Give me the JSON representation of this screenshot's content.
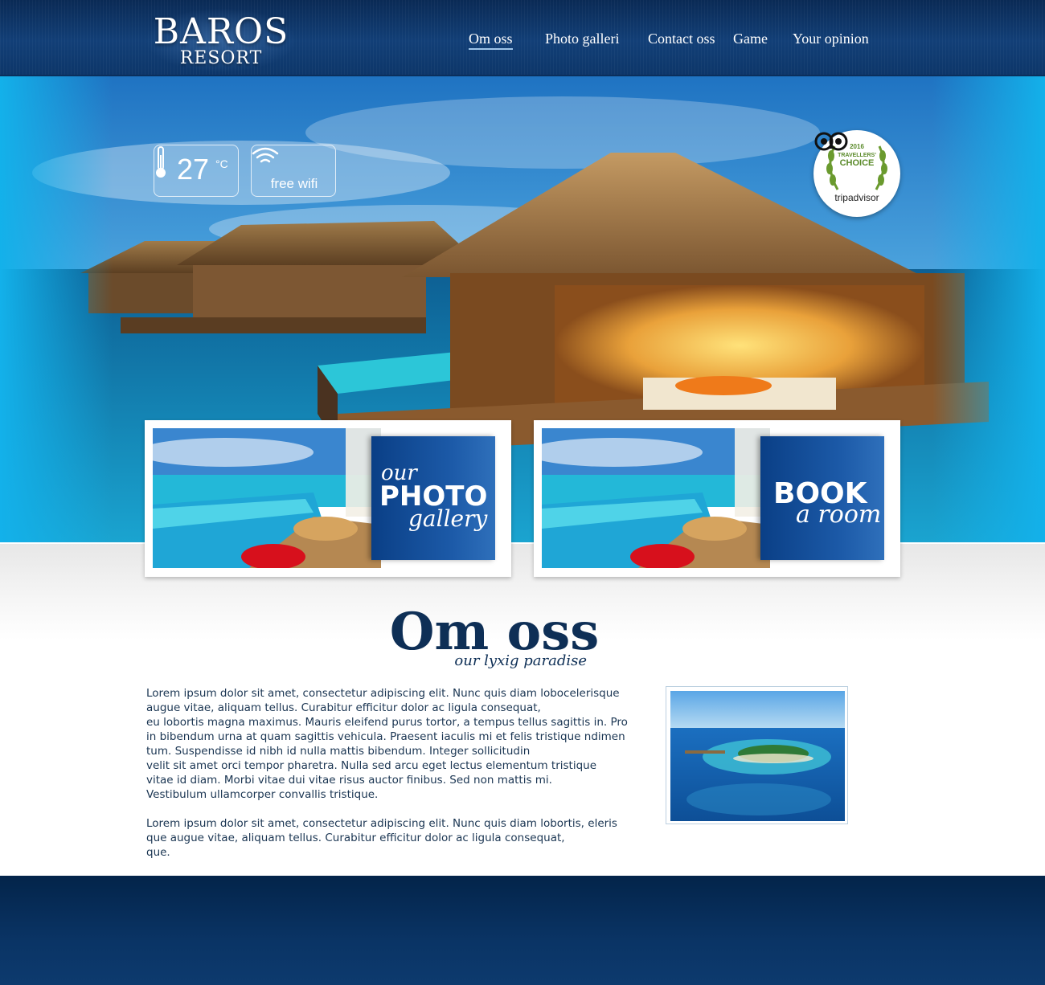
{
  "brand": {
    "name": "BAROS",
    "subtitle": "RESORT"
  },
  "nav": {
    "items": [
      {
        "label": "Om oss",
        "active": true
      },
      {
        "label": "Photo galleri",
        "active": false
      },
      {
        "label": "Contact oss",
        "active": false
      },
      {
        "label": "Game",
        "active": false
      },
      {
        "label": "Your opinion",
        "active": false
      }
    ]
  },
  "hero": {
    "weather": {
      "temperature": "27",
      "unit": "°C",
      "icon": "thermometer-icon"
    },
    "wifi": {
      "label": "free wifi",
      "icon": "wifi-icon"
    },
    "badge": {
      "year": "2016",
      "line1": "TRAVELLERS'",
      "line2": "CHOICE",
      "name": "tripadvisor",
      "icon": "owl-icon"
    }
  },
  "promos": {
    "gallery": {
      "line1": "our",
      "line2": "PHOTO",
      "line3": "gallery"
    },
    "book": {
      "line1": "BOOK",
      "line2": "a room"
    }
  },
  "about": {
    "title": "Om oss",
    "subtitle": "our lyxig paradise",
    "paragraphs": [
      "Lorem ipsum dolor sit amet, consectetur adipiscing elit. Nunc quis diam lobocelerisque\naugue vitae, aliquam tellus. Curabitur efficitur dolor ac ligula consequat,\neu lobortis magna maximus. Mauris eleifend purus tortor, a tempus tellus sagittis in. Pro\nin bibendum urna at quam sagittis vehicula. Praesent iaculis mi et felis tristique ndimen\ntum. Suspendisse id nibh id nulla mattis bibendum. Integer sollicitudin\nvelit sit amet orci tempor pharetra. Nulla sed arcu eget lectus elementum tristique\nvitae id diam. Morbi vitae dui vitae risus auctor finibus. Sed non mattis mi.\nVestibulum ullamcorper convallis tristique.",
      "Lorem ipsum dolor sit amet, consectetur adipiscing elit. Nunc quis diam lobortis, eleris\nque augue vitae, aliquam tellus. Curabitur efficitur dolor ac ligula consequat,\nque."
    ]
  },
  "colors": {
    "header": "#123f77",
    "sky": "#14b0ea",
    "panel": "#1c5aa8",
    "title": "#0e2f56",
    "footer": "#0a3465"
  }
}
